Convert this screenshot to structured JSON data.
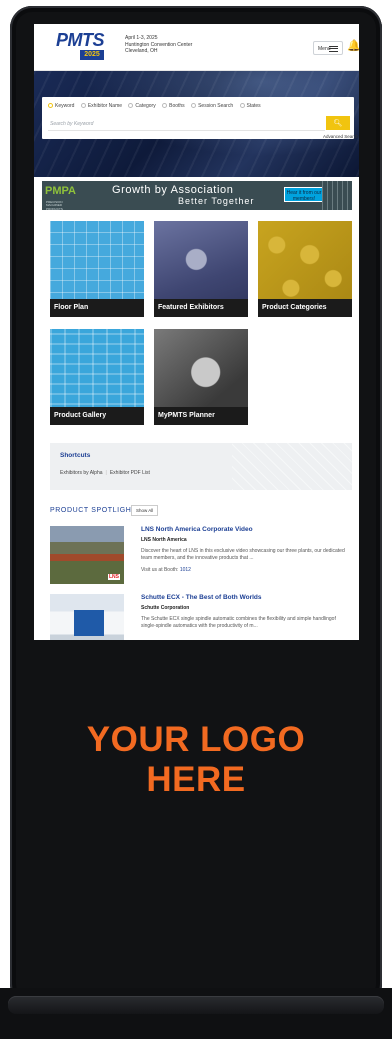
{
  "header": {
    "logo_text": "PMTS",
    "logo_year": "2025",
    "event_date": "April 1-3, 2025",
    "venue": "Huntington Convention Center",
    "city": "Cleveland, OH",
    "menu_label": "Menu"
  },
  "search": {
    "options": [
      "Keyword",
      "Exhibitor Name",
      "Category",
      "Booths",
      "Session Search",
      "States"
    ],
    "selected": "Keyword",
    "placeholder": "Search by Keyword",
    "advanced_label": "Advanced Search"
  },
  "banner": {
    "org": "PMPA",
    "org_sub": "PRECISION MACHINED PRODUCTS ASSOCIATION",
    "title": "Growth by Association",
    "subtitle": "Better Together",
    "cta": "Hear it from our members!"
  },
  "tiles": [
    "Floor Plan",
    "Featured Exhibitors",
    "Product Categories",
    "Product Gallery",
    "MyPMTS Planner"
  ],
  "shortcuts": {
    "title": "Shortcuts",
    "links": [
      "Exhibitors by Alpha",
      "Exhibitor PDF List"
    ]
  },
  "spotlight": {
    "heading": "PRODUCT SPOTLIGHT",
    "show_all": "Show All",
    "items": [
      {
        "title": "LNS North America Corporate Video",
        "company": "LNS North America",
        "description": "Discover the heart of LNS in this exclusive video showcasing our three plants, our dedicated team members, and the innovative products that ...",
        "booth_label": "Visit us at Booth:",
        "booth": "1012"
      },
      {
        "title": "Schutte ECX - The Best of Both Worlds",
        "company": "Schutte Corporation",
        "description": "The Schutte ECX single spindle automatic combines the flexibility and simple handlingof single-spindle automatics with the productivity of m..."
      }
    ]
  },
  "placeholder_logo": {
    "line1": "YOUR LOGO",
    "line2": "HERE"
  },
  "colors": {
    "accent_blue": "#1c3f94",
    "accent_yellow": "#f1c40f",
    "logo_orange": "#f26a21"
  }
}
